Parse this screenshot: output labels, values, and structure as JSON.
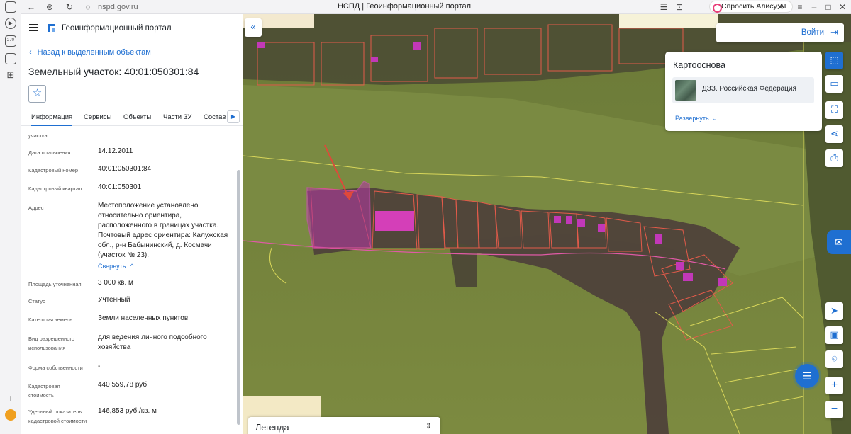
{
  "browser": {
    "url": "nspd.gov.ru",
    "tab_title": "НСПД | Геоинформационный портал",
    "alice_label": "Спросить Алису AI",
    "sidebar_badge": "270"
  },
  "panel": {
    "app_title": "Геоинформационный портал",
    "back_label": "Назад к выделенным объектам",
    "object_title": "Земельный участок: 40:01:050301:84",
    "tabs": [
      {
        "label": "Информация"
      },
      {
        "label": "Сервисы"
      },
      {
        "label": "Объекты"
      },
      {
        "label": "Части ЗУ"
      },
      {
        "label": "Состав"
      }
    ],
    "collapse_label": "Свернуть",
    "fields": [
      {
        "label": "участка",
        "value": ""
      },
      {
        "label": "Дата присвоения",
        "value": "14.12.2011"
      },
      {
        "label": "Кадастровый номер",
        "value": "40:01:050301:84"
      },
      {
        "label": "Кадастровый квартал",
        "value": "40:01:050301"
      },
      {
        "label": "Адрес",
        "value": "Местоположение установлено относительно ориентира, расположенного в границах участка. Почтовый адрес ориентира: Калужская обл., р-н Бабынинский, д. Космачи (участок № 23)."
      },
      {
        "label": "Площадь уточненная",
        "value": "3 000 кв. м"
      },
      {
        "label": "Статус",
        "value": "Учтенный"
      },
      {
        "label": "Категория земель",
        "value": "Земли населенных пунктов"
      },
      {
        "label": "Вид разрешенного использования",
        "value": "для ведения личного подсобного хозяйства"
      },
      {
        "label": "Форма собственности",
        "value": "-"
      },
      {
        "label": "Кадастровая стоимость",
        "value": "440 559,78 руб."
      },
      {
        "label": "Удельный показатель кадастровой стоимости",
        "value": "146,853 руб./кв. м"
      }
    ]
  },
  "map": {
    "login_label": "Войти",
    "basemap_title": "Картооснова",
    "basemap_item": "ДЗЗ. Российская Федерация",
    "expand_label": "Развернуть",
    "legend_label": "Легенда",
    "tools": [
      "select-icon",
      "ruler-icon",
      "area-select-icon",
      "share-icon",
      "print-icon",
      "navigate-icon",
      "layers-icon",
      "pin-icon",
      "zoom-in-icon",
      "zoom-out-icon"
    ]
  }
}
